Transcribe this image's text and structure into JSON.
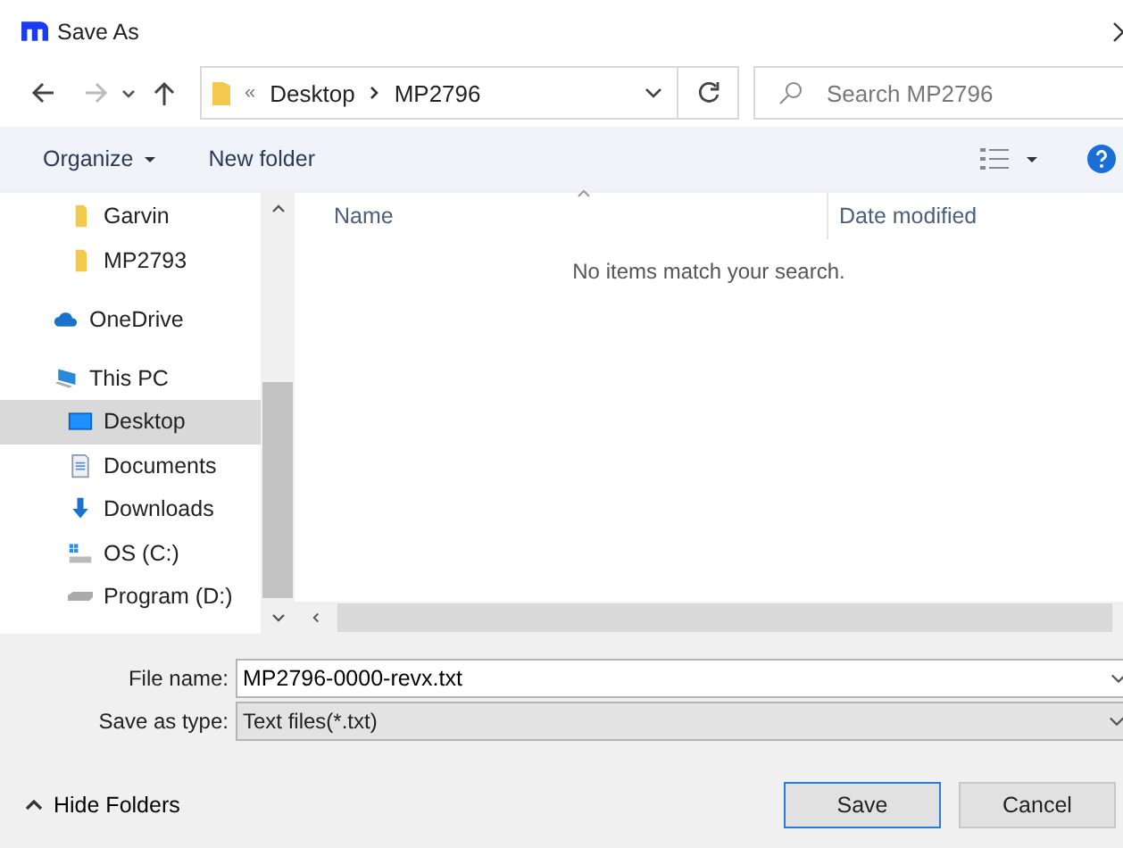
{
  "window": {
    "title": "Save As"
  },
  "address": {
    "overflow": "«",
    "crumbs": [
      "Desktop",
      "MP2796"
    ]
  },
  "search": {
    "placeholder": "Search MP2796"
  },
  "toolbar": {
    "organize": "Organize",
    "new_folder": "New folder"
  },
  "sidebar": {
    "scrolled_children": [
      {
        "label": "Garvin",
        "kind": "folder",
        "selected": false
      },
      {
        "label": "MP2793",
        "kind": "folder",
        "selected": false
      }
    ],
    "items": [
      {
        "label": "OneDrive",
        "kind": "cloud",
        "selected": false
      },
      {
        "label": "This PC",
        "kind": "pc",
        "selected": false,
        "children": [
          {
            "label": "Desktop",
            "kind": "desktop",
            "selected": true
          },
          {
            "label": "Documents",
            "kind": "documents",
            "selected": false
          },
          {
            "label": "Downloads",
            "kind": "downloads",
            "selected": false
          },
          {
            "label": "OS (C:)",
            "kind": "windrive",
            "selected": false
          },
          {
            "label": "Program (D:)",
            "kind": "drive",
            "selected": false
          }
        ]
      }
    ]
  },
  "table": {
    "columns": [
      "Name",
      "Date modified"
    ],
    "empty_message": "No items match your search."
  },
  "form": {
    "file_name_label": "File name:",
    "file_name": "MP2796-0000-revx.txt",
    "type_label": "Save as type:",
    "type": "Text files(*.txt)"
  },
  "hide_folders": "Hide Folders",
  "buttons": [
    {
      "label": "Save",
      "kind": "default"
    },
    {
      "label": "Cancel",
      "kind": "normal"
    }
  ]
}
